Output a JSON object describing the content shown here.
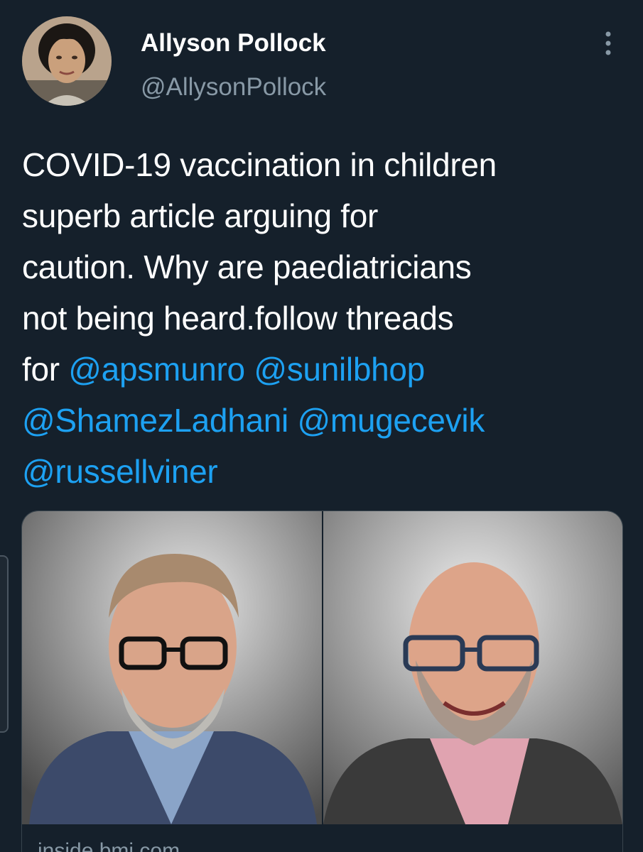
{
  "author": {
    "name": "Allyson Pollock",
    "handle": "@AllysonPollock",
    "avatar_icon": "profile-photo"
  },
  "menu": {
    "icon": "more-vertical-icon"
  },
  "tweet": {
    "text_line1": "COVID-19 vaccination in children",
    "text_line2": "superb article arguing for",
    "text_line3": "caution. Why are paediatricians",
    "text_line4": "not being heard.follow threads",
    "text_line5_prefix": "for ",
    "mentions": [
      "@apsmunro",
      "@sunilbhop",
      "@ShamezLadhani",
      "@mugecevik",
      "@russellviner"
    ]
  },
  "media": {
    "left_photo_icon": "portrait-photo-man-glasses-beard",
    "right_photo_icon": "portrait-photo-man-bald-glasses",
    "link_preview_text": "inside.bmj.com"
  },
  "colors": {
    "background": "#15202b",
    "text": "#ffffff",
    "secondary": "#8899a6",
    "link": "#1da1f2",
    "border": "#38444d"
  }
}
